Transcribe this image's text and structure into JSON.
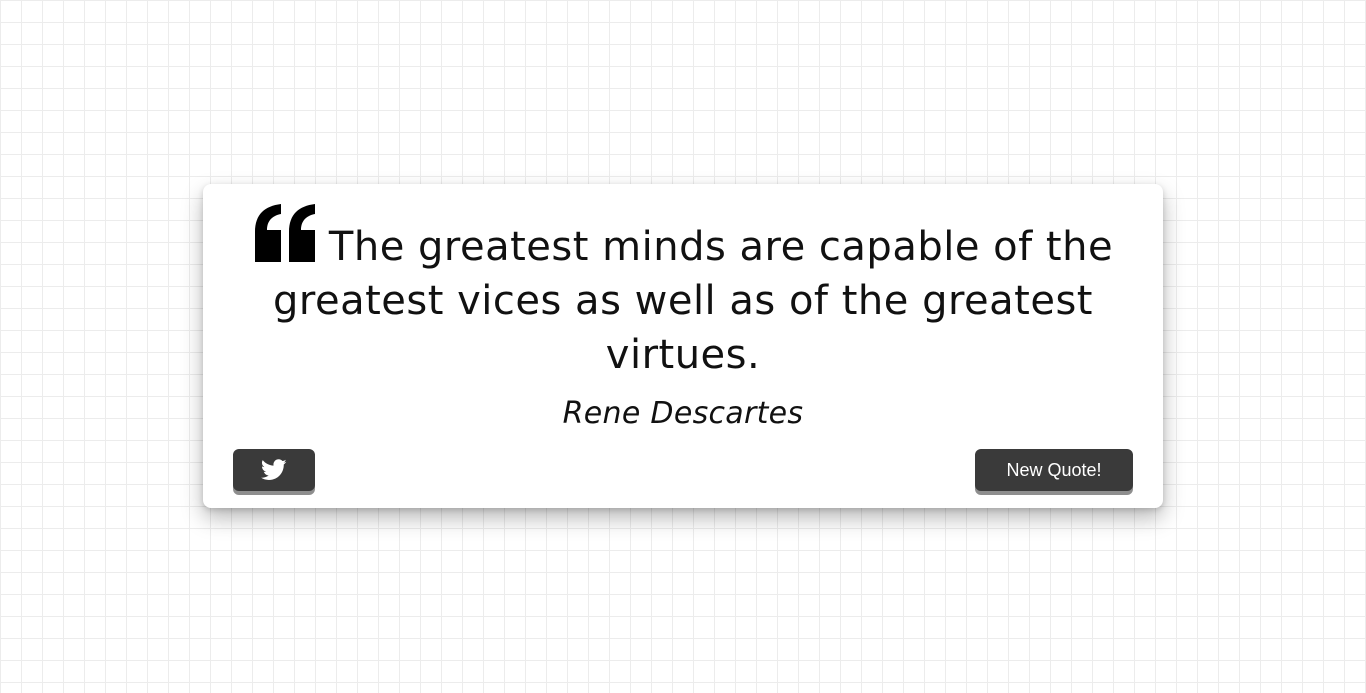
{
  "quote": {
    "text": "The greatest minds are capable of the greatest vices as well as of the greatest virtues.",
    "author": "Rene Descartes",
    "icon": "quote-left-icon"
  },
  "actions": {
    "tweet_icon": "twitter-icon",
    "new_quote_label": "New Quote!"
  },
  "colors": {
    "button_bg": "#3a3a3a",
    "button_text": "#ffffff",
    "text": "#111111",
    "card_bg": "#ffffff"
  }
}
